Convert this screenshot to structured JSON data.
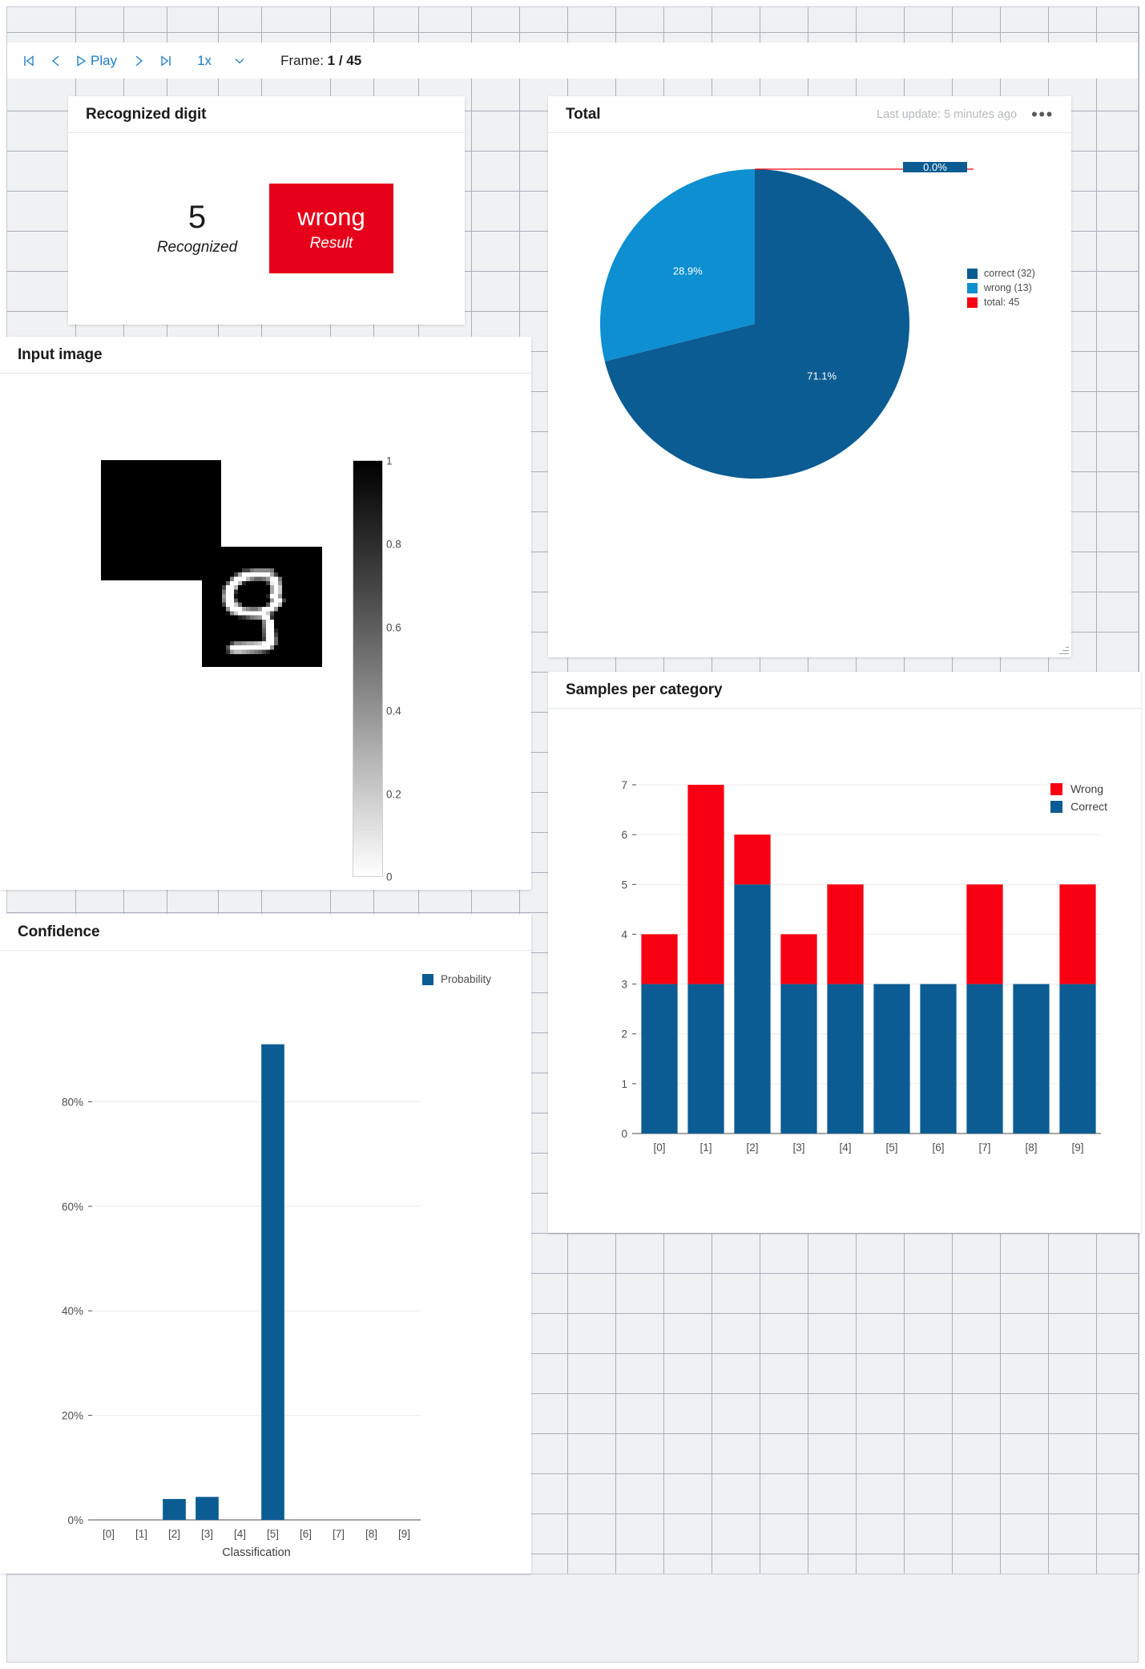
{
  "toolbar": {
    "first_frame_label": "|<",
    "prev_frame_label": "<",
    "play_label": "Play",
    "next_frame_label": ">",
    "last_frame_label": ">|",
    "speed_label": "1x",
    "frame_prefix": "Frame: ",
    "frame_current": "1",
    "frame_separator": " / ",
    "frame_total": "45"
  },
  "recognized_card": {
    "title": "Recognized digit",
    "digit_value": "5",
    "digit_caption": "Recognized",
    "result_value": "wrong",
    "result_caption": "Result",
    "result_color": "#e60019"
  },
  "input_card": {
    "title": "Input image",
    "colorbar_ticks": [
      "1",
      "0.8",
      "0.6",
      "0.4",
      "0.2",
      "0"
    ]
  },
  "total_card": {
    "title": "Total",
    "last_update": "Last update: 5 minutes ago",
    "menu_label": "•••"
  },
  "samples_card": {
    "title": "Samples per category"
  },
  "confidence_card": {
    "title": "Confidence"
  },
  "colors": {
    "dark_blue": "#0b5c92",
    "mid_blue": "#0d7fc4",
    "light_blue": "#0d8fd1",
    "red": "#f80011",
    "accent": "#1a7dc4"
  },
  "chart_data": [
    {
      "id": "total-pie",
      "type": "pie",
      "title": "Total",
      "legend_position": "right",
      "labels": [
        "correct (32)",
        "wrong (13)",
        "total: 45"
      ],
      "slice_labels": [
        "71.1%",
        "28.9%",
        "0.0%"
      ],
      "values": [
        71.1,
        28.9,
        0.0
      ],
      "raw_counts": [
        32,
        13,
        45
      ],
      "colors": [
        "#0b5c92",
        "#0d8fd1",
        "#f80011"
      ]
    },
    {
      "id": "samples-per-category",
      "type": "bar",
      "title": "Samples per category",
      "stacked": true,
      "categories": [
        "[0]",
        "[1]",
        "[2]",
        "[3]",
        "[4]",
        "[5]",
        "[6]",
        "[7]",
        "[8]",
        "[9]"
      ],
      "series": [
        {
          "name": "Correct",
          "color": "#0b5c92",
          "values": [
            3,
            3,
            5,
            3,
            3,
            3,
            3,
            3,
            3,
            3
          ]
        },
        {
          "name": "Wrong",
          "color": "#f80011",
          "values": [
            1,
            4,
            1,
            1,
            2,
            0,
            0,
            2,
            0,
            2
          ]
        }
      ],
      "totals": [
        4,
        7,
        6,
        4,
        5,
        3,
        3,
        5,
        3,
        5
      ],
      "ylim": [
        0,
        7
      ],
      "yticks": [
        "0",
        "1",
        "2",
        "3",
        "4",
        "5",
        "6",
        "7"
      ],
      "xlabel": "",
      "ylabel": "",
      "grid": true,
      "legend_position": "top-right"
    },
    {
      "id": "confidence",
      "type": "bar",
      "title": "Confidence",
      "categories": [
        "[0]",
        "[1]",
        "[2]",
        "[3]",
        "[4]",
        "[5]",
        "[6]",
        "[7]",
        "[8]",
        "[9]"
      ],
      "series": [
        {
          "name": "Probability",
          "color": "#0b5c92",
          "values": [
            0,
            0,
            4.0,
            4.4,
            0,
            91.0,
            0,
            0,
            0,
            0
          ]
        }
      ],
      "ylim": [
        0,
        100
      ],
      "yticks": [
        "0%",
        "20%",
        "40%",
        "60%",
        "80%"
      ],
      "ytick_values": [
        0,
        20,
        40,
        60,
        80
      ],
      "xlabel": "Classification",
      "ylabel": "",
      "grid": true,
      "legend_position": "top-right"
    }
  ],
  "mnist": {
    "label": "digit-9-grayscale",
    "rows": [
      "000000000000000000000000000000",
      "000000000000000000000000000000",
      "000000000000000000000000000000",
      "000000000000000000000000000000",
      "000000000000000000000000000000",
      "000000000044788887000000000000",
      "000000004AFFFFFFFA40000000000",
      "00000008FFFB86679FF7000000000",
      "0000006FFB2000004EF9000000000",
      "000004FFB00000000AFC000000000",
      "000007FF300000000AFC000000000",
      "000009FF100000002FF9000000000",
      "000008FF5000000009FF400000000",
      "000004FFC60000005FFB000000000",
      "0000009FFFA8779FFF90000000000",
      "00000018CFFFFFFFC500000000000",
      "000000000235789FF300000000000",
      "0000000000000008FF000000000000",
      "0000000000000007FF000000000000",
      "0000000000000006FF200000000000",
      "0000000000000005FF400000000000",
      "0000000000000004FF600000000000",
      "00000004889AABCFFF600000000000",
      "0000005FFFFFFFFFF9000000000000",
      "00000039BBA9876420000000000000",
      "000000000000000000000000000000",
      "000000000000000000000000000000",
      "000000000000000000000000000000"
    ]
  }
}
